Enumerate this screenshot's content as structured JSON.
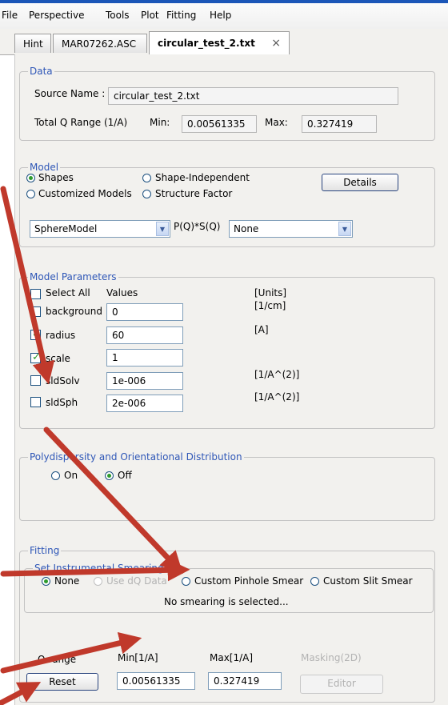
{
  "menu": [
    "File",
    "Perspective",
    "Tools",
    "Plot",
    "Fitting",
    "Help"
  ],
  "tabs": [
    {
      "label": "Hint"
    },
    {
      "label": "MAR07262.ASC"
    },
    {
      "label": "circular_test_2.txt",
      "close": "×"
    }
  ],
  "data_group": {
    "title": "Data",
    "source_label": "Source Name :",
    "source_value": "circular_test_2.txt",
    "range_label": "Total Q Range (1/A)",
    "min_label": "Min:",
    "min_value": "0.00561335",
    "max_label": "Max:",
    "max_value": "0.327419"
  },
  "model_group": {
    "title": "Model",
    "radios": [
      "Shapes",
      "Shape-Independent",
      "Customized Models",
      "Structure Factor"
    ],
    "selected": "Shapes",
    "details_button": "Details",
    "model_select": "SphereModel",
    "pq_label": "P(Q)*S(Q)",
    "sq_select": "None"
  },
  "params_group": {
    "title": "Model Parameters",
    "select_all": "Select All",
    "values_header": "Values",
    "units_header": "[Units]",
    "rows": [
      {
        "name": "background",
        "value": "0",
        "unit": "[1/cm]",
        "checked": false
      },
      {
        "name": "radius",
        "value": "60",
        "unit": "[A]",
        "checked": true
      },
      {
        "name": "scale",
        "value": "1",
        "unit": "",
        "checked": true
      },
      {
        "name": "sldSolv",
        "value": "1e-006",
        "unit": "[1/A^(2)]",
        "checked": false
      },
      {
        "name": "sldSph",
        "value": "2e-006",
        "unit": "[1/A^(2)]",
        "checked": false
      }
    ]
  },
  "poly_group": {
    "title": "Polydispersity and Orientational Distribution",
    "on_label": "On",
    "off_label": "Off",
    "selected": "Off"
  },
  "fitting_group": {
    "title": "Fitting",
    "smear_title": "Set Instrumental Smearing",
    "smear_options": [
      "None",
      "Use dQ Data",
      "Custom Pinhole Smear",
      "Custom Slit Smear"
    ],
    "smear_selected": "None",
    "smear_status": "No smearing is selected...",
    "qrange_label": "Q range",
    "min_header": "Min[1/A]",
    "max_header": "Max[1/A]",
    "masking_header": "Masking(2D)",
    "reset_button": "Reset",
    "qmin_value": "0.00561335",
    "qmax_value": "0.327419",
    "editor_button": "Editor"
  },
  "colors": {
    "arrow": "#c0392b",
    "group_title": "#2f57b7",
    "radio_on": "#2d9b2d"
  }
}
